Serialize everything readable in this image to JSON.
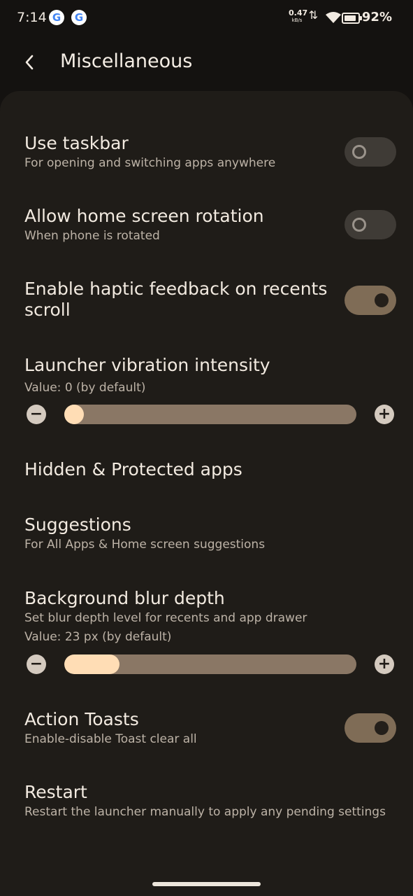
{
  "status": {
    "time": "7:14",
    "net_speed": "0.47",
    "net_unit": "kB/s",
    "battery": "92%",
    "icons": [
      "google-icon",
      "google-icon",
      "data-arrows-icon",
      "wifi-icon",
      "battery-icon"
    ]
  },
  "header": {
    "title": "Miscellaneous"
  },
  "settings": {
    "taskbar": {
      "title": "Use taskbar",
      "subtitle": "For opening and switching apps anywhere",
      "enabled": false
    },
    "rotation": {
      "title": "Allow home screen rotation",
      "subtitle": "When phone is rotated",
      "enabled": false
    },
    "haptic": {
      "title": "Enable haptic feedback on recents scroll",
      "enabled": true
    },
    "vibration": {
      "title": "Launcher vibration intensity",
      "value_text": "Value: 0 (by default)",
      "value": 0
    },
    "hidden": {
      "title": "Hidden & Protected apps"
    },
    "suggestions": {
      "title": "Suggestions",
      "subtitle": "For All Apps & Home screen suggestions"
    },
    "blur": {
      "title": "Background blur depth",
      "subtitle": "Set blur depth level for recents and app drawer",
      "value_text": "Value: 23 px (by default)",
      "fraction": 0.19
    },
    "toasts": {
      "title": "Action Toasts",
      "subtitle": "Enable-disable Toast clear all",
      "enabled": true
    },
    "restart": {
      "title": "Restart",
      "subtitle": "Restart the launcher manually to apply any pending settings"
    }
  },
  "slider_buttons": {
    "minus": "−",
    "plus": "+"
  },
  "colors": {
    "accent": "#FFDDB5",
    "toggle_on": "#7F6C56",
    "toggle_off": "#3F3B36",
    "surface": "#1F1C18",
    "background": "#141210"
  }
}
